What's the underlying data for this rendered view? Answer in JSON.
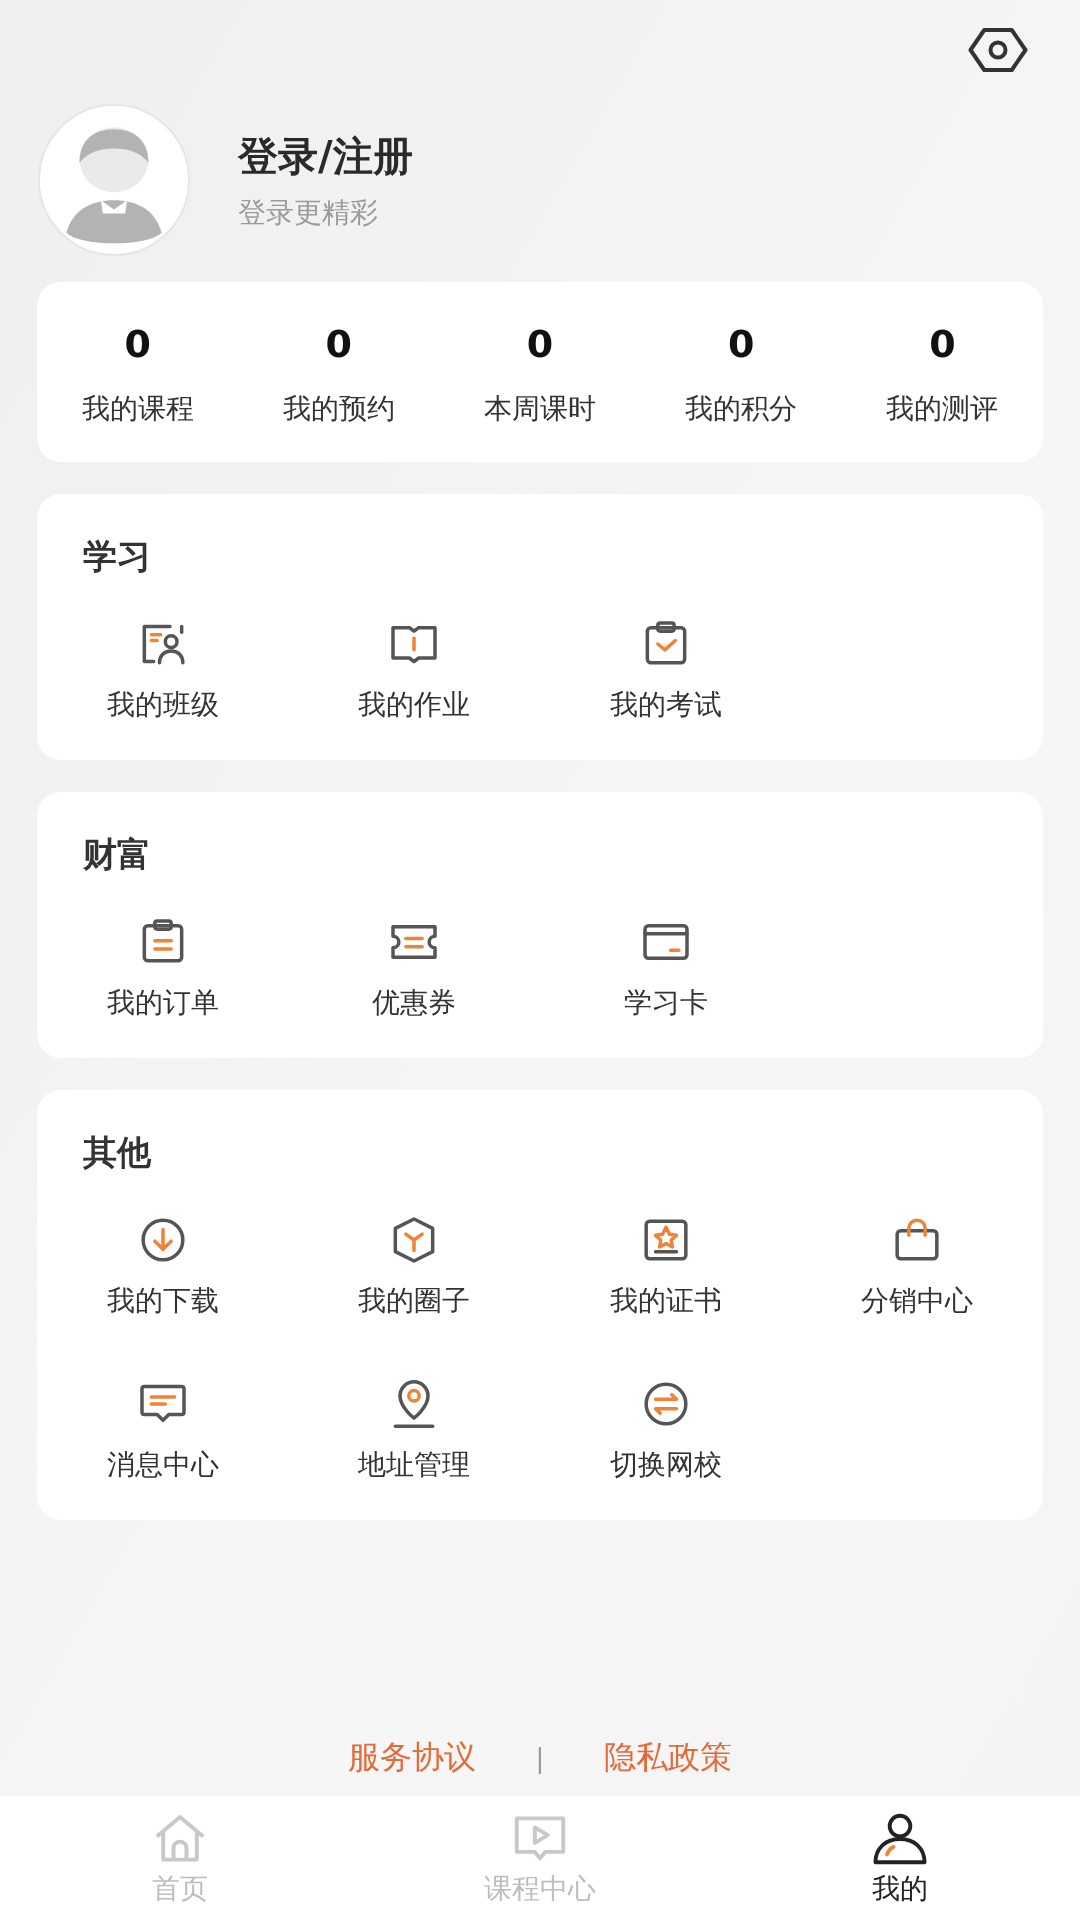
{
  "profile": {
    "title": "登录/注册",
    "subtitle": "登录更精彩"
  },
  "stats": [
    {
      "value": "0",
      "label": "我的课程"
    },
    {
      "value": "0",
      "label": "我的预约"
    },
    {
      "value": "0",
      "label": "本周课时"
    },
    {
      "value": "0",
      "label": "我的积分"
    },
    {
      "value": "0",
      "label": "我的测评"
    }
  ],
  "sections": [
    {
      "title": "学习",
      "items": [
        {
          "label": "我的班级"
        },
        {
          "label": "我的作业"
        },
        {
          "label": "我的考试"
        }
      ]
    },
    {
      "title": "财富",
      "items": [
        {
          "label": "我的订单"
        },
        {
          "label": "优惠券"
        },
        {
          "label": "学习卡"
        }
      ]
    },
    {
      "title": "其他",
      "items": [
        {
          "label": "我的下载"
        },
        {
          "label": "我的圈子"
        },
        {
          "label": "我的证书"
        },
        {
          "label": "分销中心"
        },
        {
          "label": "消息中心"
        },
        {
          "label": "地址管理"
        },
        {
          "label": "切换网校"
        }
      ]
    }
  ],
  "footer_links": [
    "服务协议",
    "|",
    "隐私政策"
  ],
  "tab_bar": [
    {
      "label": "首页",
      "selected": false
    },
    {
      "label": "课程中心",
      "selected": false
    },
    {
      "label": "我的",
      "selected": true
    }
  ]
}
